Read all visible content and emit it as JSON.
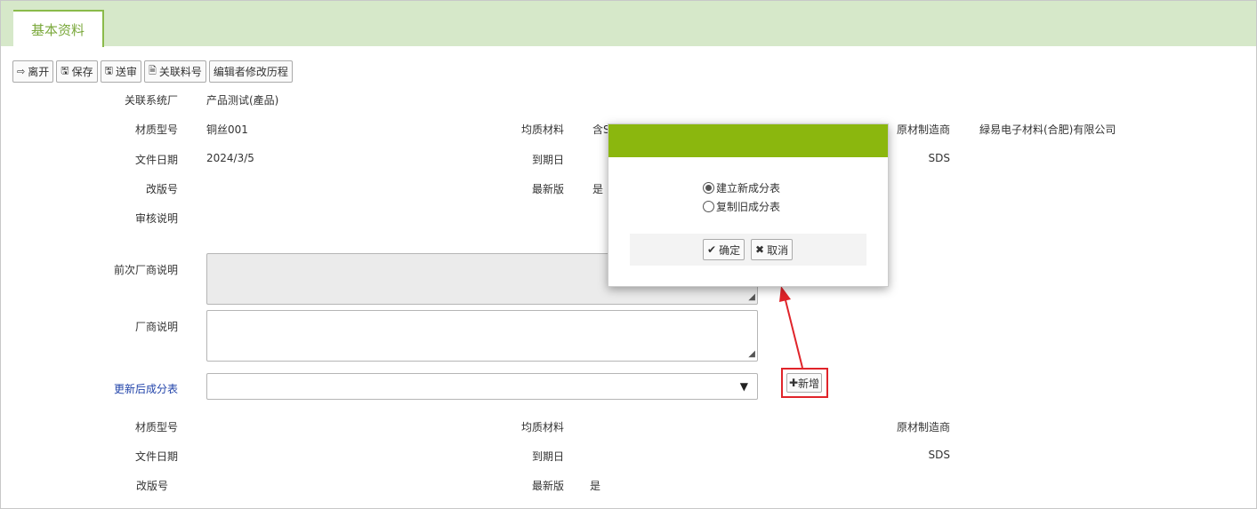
{
  "tab": {
    "label": "基本资料"
  },
  "toolbar": [
    {
      "icon": "exit-icon",
      "glyph": "⇨",
      "label": "离开"
    },
    {
      "icon": "save-icon",
      "glyph": "🖫",
      "label": "保存"
    },
    {
      "icon": "submit-icon",
      "glyph": "🖫",
      "label": "送审"
    },
    {
      "icon": "document-icon",
      "glyph": "🗎",
      "label": "关联料号"
    },
    {
      "icon": "",
      "glyph": "",
      "label": "编辑者修改历程"
    }
  ],
  "form": {
    "factory_label": "关联系统厂",
    "factory_value": "产品测试(產品)",
    "material_model_label": "材质型号",
    "material_model_value": "铜丝001",
    "homogeneous_label": "均质材料",
    "homogeneous_value": "含S",
    "raw_maker_label": "原材制造商",
    "raw_maker_value": "緑易电子材料(合肥)有限公司",
    "doc_date_label": "文件日期",
    "doc_date_value": "2024/3/5",
    "expiry_label": "到期日",
    "sds_label": "SDS",
    "revision_label": "改版号",
    "latest_label": "最新版",
    "latest_value": "是",
    "review_note_label": "审核说明",
    "prev_vendor_note_label": "前次厂商说明",
    "vendor_note_label": "厂商说明",
    "update_table_label": "更新后成分表",
    "add_button": "新增"
  },
  "lower": {
    "material_model_label": "材质型号",
    "homogeneous_label": "均质材料",
    "raw_maker_label": "原材制造商",
    "doc_date_label": "文件日期",
    "expiry_label": "到期日",
    "sds_label": "SDS",
    "revision_label": "改版号",
    "latest_label": "最新版",
    "latest_value": "是"
  },
  "modal": {
    "option_new": "建立新成分表",
    "option_copy": "复制旧成分表",
    "selected": "option_new",
    "confirm": "确定",
    "cancel": "取消",
    "header_color": "#8bb70e"
  },
  "colors": {
    "annotation": "#e0242a",
    "tab_accent": "#7aa83b",
    "tabbar_bg": "#d6e8c9"
  }
}
